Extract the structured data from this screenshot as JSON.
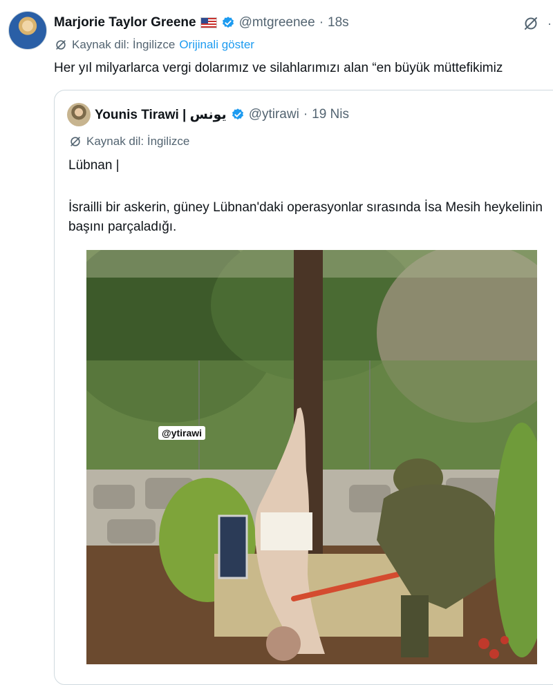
{
  "tweet": {
    "author_name": "Marjorie Taylor Greene",
    "flag_icon": "us-flag-icon",
    "handle": "@mtgreenee",
    "separator": "·",
    "time": "18s",
    "translation_label": "Kaynak dil: İngilizce",
    "show_original": "Orijinali göster",
    "text": "Her yıl milyarlarca vergi dolarımız ve silahlarımızı alan “en büyük müttefikimiz"
  },
  "quoted_tweet": {
    "author_name": "Younis Tirawi | يونس",
    "handle": "@ytirawi",
    "separator": "·",
    "time": "19 Nis",
    "translation_label": "Kaynak dil: İngilizce",
    "line1": "Lübnan |",
    "paragraph": "İsrailli bir askerin, güney Lübnan'daki operasyonlar sırasında İsa Mesih heykelinin başını parçaladığı.",
    "photo_watermark": "@ytirawi"
  },
  "colors": {
    "verified": "#1d9bf0",
    "link": "#1d9bf0",
    "muted": "#536471"
  }
}
